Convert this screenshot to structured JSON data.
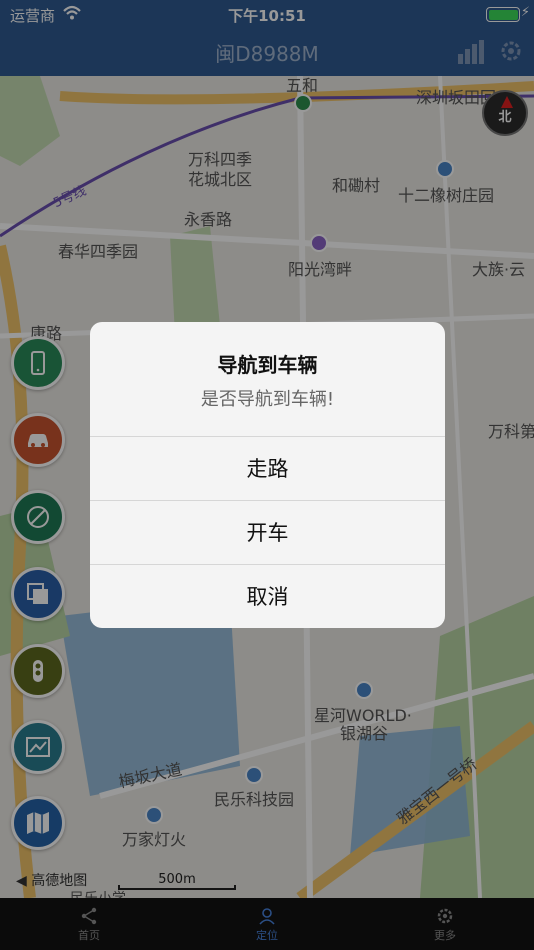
{
  "status_bar": {
    "carrier": "运营商",
    "time": "下午10:51",
    "battery_level": 1.0
  },
  "header": {
    "title": "闽D8988M"
  },
  "map": {
    "labels": [
      {
        "text": "五和"
      },
      {
        "text": "深圳坂田回"
      },
      {
        "text": "万科四季"
      },
      {
        "text": "花城北区"
      },
      {
        "text": "和磡村"
      },
      {
        "text": "十二橡树庄园"
      },
      {
        "text": "5号线"
      },
      {
        "text": "永香路"
      },
      {
        "text": "春华四季园"
      },
      {
        "text": "阳光湾畔"
      },
      {
        "text": "大族·云"
      },
      {
        "text": "万科第"
      },
      {
        "text": "康路"
      },
      {
        "text": "星河WORLD·"
      },
      {
        "text": "银湖谷"
      },
      {
        "text": "梅坂大道"
      },
      {
        "text": "民乐科技园"
      },
      {
        "text": "雅宝西一号桥"
      },
      {
        "text": "万家灯火"
      },
      {
        "text": "民乐小学"
      }
    ],
    "compass_label": "北",
    "brand": "高德地图",
    "scale_label": "500m"
  },
  "dialog": {
    "title": "导航到车辆",
    "message": "是否导航到车辆!",
    "buttons": [
      "走路",
      "开车",
      "取消"
    ]
  },
  "side_buttons": [
    {
      "icon": "phone-icon",
      "color": "#2a8c5a"
    },
    {
      "icon": "car-icon",
      "color": "#c9542f"
    },
    {
      "icon": "no-fence-icon",
      "color": "#1f7a55"
    },
    {
      "icon": "layers-icon",
      "color": "#2b5fa8"
    },
    {
      "icon": "traffic-light-icon",
      "color": "#5e6a1e"
    },
    {
      "icon": "track-icon",
      "color": "#2a7d8f"
    },
    {
      "icon": "map-icon",
      "color": "#2563a8"
    }
  ],
  "tab_bar": {
    "tabs": [
      {
        "label": "首页",
        "icon": "share-icon"
      },
      {
        "label": "定位",
        "icon": "user-icon"
      },
      {
        "label": "更多",
        "icon": "gear-icon"
      }
    ]
  }
}
